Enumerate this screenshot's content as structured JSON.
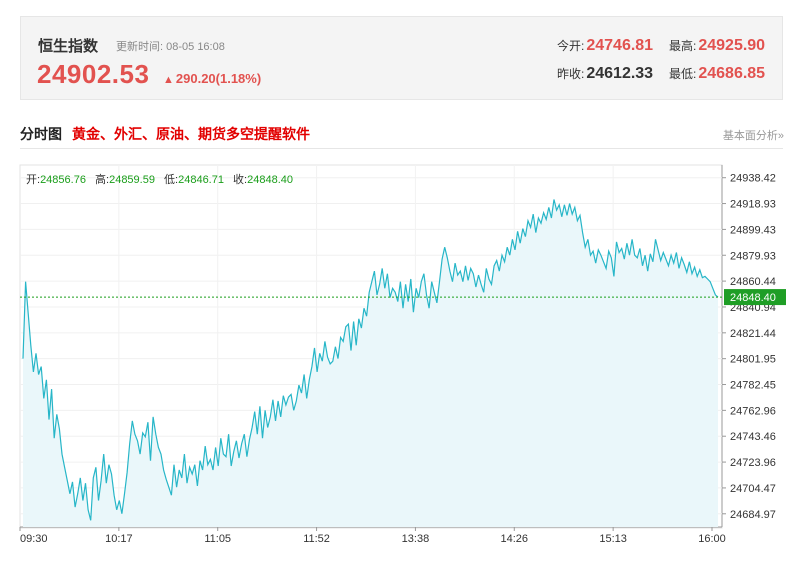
{
  "quote": {
    "name": "恒生指数",
    "update_label": "更新时间:",
    "update_time": "08-05 16:08",
    "price": "24902.53",
    "arrow": "🠅",
    "change": "290.20(1.18%)",
    "open_label": "今开:",
    "open_value": "24746.81",
    "high_label": "最高:",
    "high_value": "24925.90",
    "prev_close_label": "昨收:",
    "prev_close_value": "24612.33",
    "low_label": "最低:",
    "low_value": "24686.85"
  },
  "section": {
    "title": "分时图",
    "promo_link": "黄金、外汇、原油、期货多空提醒软件",
    "fund_link": "基本面分析»"
  },
  "ohlc_bar": {
    "open_label": "开:",
    "open_value": "24856.76",
    "high_label": "高:",
    "high_value": "24859.59",
    "low_label": "低:",
    "low_value": "24846.71",
    "close_label": "收:",
    "close_value": "24848.40"
  },
  "current_tag": "24848.40",
  "colors": {
    "line": "#27b6c8",
    "fill": "#eaf7fa",
    "up": "#e2524f",
    "ohlc_value": "#1a9e1a",
    "current_tag_bg": "#1f9e26"
  },
  "chart_data": {
    "type": "area",
    "title": "",
    "xlabel": "",
    "ylabel": "",
    "ylim": [
      24675.0,
      24948.0
    ],
    "reference_price": 24848.4,
    "x_ticks": [
      "09:30",
      "10:17",
      "11:05",
      "11:52",
      "13:38",
      "14:26",
      "15:13",
      "16:00"
    ],
    "y_ticks": [
      24938.42,
      24918.93,
      24899.43,
      24879.93,
      24860.44,
      24840.94,
      24821.44,
      24801.95,
      24782.45,
      24762.96,
      24743.46,
      24723.96,
      24704.47,
      24684.97
    ],
    "series": [
      {
        "values": [
          24802,
          24860,
          24836,
          24812,
          24792,
          24806,
          24790,
          24796,
          24772,
          24786,
          24756,
          24779,
          24742,
          24760,
          24749,
          24730,
          24720,
          24710,
          24700,
          24709,
          24690,
          24700,
          24712,
          24695,
          24708,
          24688,
          24680,
          24712,
          24720,
          24695,
          24710,
          24730,
          24708,
          24722,
          24715,
          24699,
          24688,
          24695,
          24685,
          24700,
          24716,
          24738,
          24755,
          24745,
          24740,
          24730,
          24746,
          24743,
          24754,
          24725,
          24758,
          24745,
          24735,
          24730,
          24718,
          24711,
          24705,
          24699,
          24722,
          24705,
          24718,
          24712,
          24730,
          24708,
          24720,
          24715,
          24722,
          24706,
          24725,
          24718,
          24736,
          24722,
          24726,
          24718,
          24735,
          24721,
          24742,
          24730,
          24728,
          24745,
          24721,
          24732,
          24740,
          24727,
          24738,
          24745,
          24728,
          24741,
          24750,
          24762,
          24745,
          24766,
          24742,
          24763,
          24750,
          24758,
          24771,
          24755,
          24770,
          24758,
          24774,
          24767,
          24773,
          24775,
          24763,
          24770,
          24782,
          24776,
          24790,
          24772,
          24786,
          24796,
          24810,
          24792,
          24806,
          24800,
          24815,
          24803,
          24798,
          24800,
          24811,
          24802,
          24818,
          24815,
          24826,
          24828,
          24808,
          24830,
          24812,
          24832,
          24825,
          24840,
          24834,
          24852,
          24860,
          24868,
          24850,
          24858,
          24870,
          24855,
          24866,
          24848,
          24855,
          24852,
          24845,
          24860,
          24840,
          24858,
          24845,
          24862,
          24837,
          24855,
          24848,
          24860,
          24866,
          24850,
          24840,
          24860,
          24852,
          24844,
          24860,
          24877,
          24886,
          24878,
          24868,
          24860,
          24874,
          24865,
          24868,
          24860,
          24872,
          24861,
          24870,
          24866,
          24856,
          24865,
          24858,
          24852,
          24870,
          24862,
          24858,
          24872,
          24876,
          24868,
          24880,
          24875,
          24886,
          24880,
          24892,
          24884,
          24898,
          24889,
          24900,
          24894,
          24906,
          24901,
          24911,
          24897,
          24908,
          24904,
          24912,
          24907,
          24916,
          24908,
          24922,
          24914,
          24918,
          24909,
          24918,
          24910,
          24919,
          24911,
          24916,
          24906,
          24910,
          24897,
          24886,
          24892,
          24880,
          24883,
          24874,
          24884,
          24880,
          24875,
          24870,
          24883,
          24878,
          24864,
          24890,
          24882,
          24885,
          24877,
          24889,
          24880,
          24892,
          24880,
          24878,
          24885,
          24872,
          24880,
          24868,
          24881,
          24875,
          24892,
          24884,
          24876,
          24882,
          24877,
          24872,
          24880,
          24874,
          24882,
          24870,
          24878,
          24873,
          24867,
          24875,
          24866,
          24871,
          24864,
          24869,
          24863,
          24864,
          24862,
          24860,
          24855,
          24850,
          24848.4
        ]
      }
    ]
  }
}
